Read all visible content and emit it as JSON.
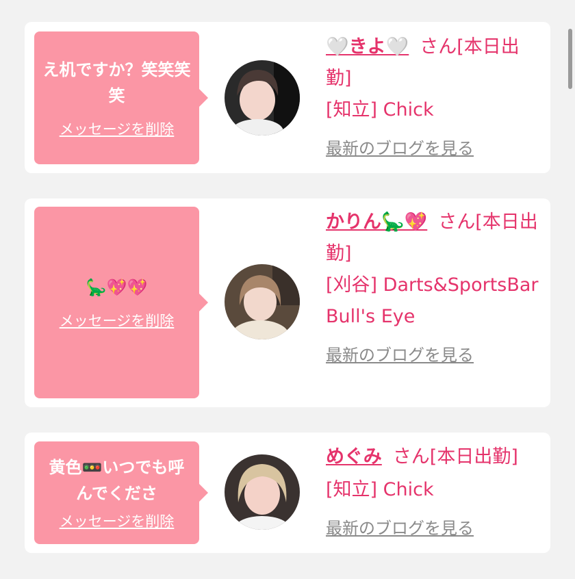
{
  "cards": [
    {
      "message": "え机ですか？笑笑笑笑",
      "delete_label": "メッセージを削除",
      "name": "🤍きよ🤍",
      "honorific": "さん[本日出勤]",
      "shop": "[知立] Chick",
      "blog_label": "最新のブログを見る"
    },
    {
      "message": "🦕💖💖",
      "delete_label": "メッセージを削除",
      "name": "かりん🦕💖",
      "honorific": "さん[本日出勤]",
      "shop": "[刈谷] Darts&SportsBar Bull's Eye",
      "blog_label": "最新のブログを見る"
    },
    {
      "message": "黄色🚥いつでも呼んでくださ",
      "delete_label": "メッセージを削除",
      "name": "めぐみ",
      "honorific": "さん[本日出勤]",
      "shop": "[知立] Chick",
      "blog_label": "最新のブログを見る"
    }
  ]
}
